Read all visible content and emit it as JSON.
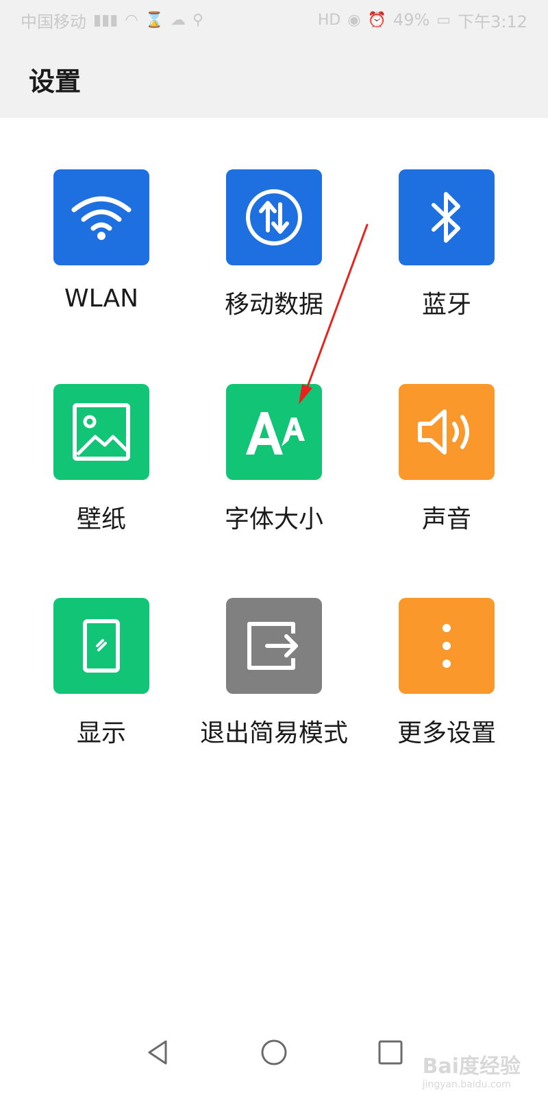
{
  "status_bar": {
    "carrier": "中国移动",
    "battery": "49%",
    "time": "下午3:12"
  },
  "header": {
    "title": "设置"
  },
  "tiles": [
    {
      "label": "WLAN",
      "icon": "wifi-icon",
      "color": "#1e6fe0"
    },
    {
      "label": "移动数据",
      "icon": "mobile-data-icon",
      "color": "#1e6fe0"
    },
    {
      "label": "蓝牙",
      "icon": "bluetooth-icon",
      "color": "#1e6fe0"
    },
    {
      "label": "壁纸",
      "icon": "wallpaper-icon",
      "color": "#12c576"
    },
    {
      "label": "字体大小",
      "icon": "font-size-icon",
      "color": "#12c576"
    },
    {
      "label": "声音",
      "icon": "sound-icon",
      "color": "#fb982c"
    },
    {
      "label": "显示",
      "icon": "display-icon",
      "color": "#12c576"
    },
    {
      "label": "退出简易模式",
      "icon": "exit-icon",
      "color": "#808080"
    },
    {
      "label": "更多设置",
      "icon": "more-icon",
      "color": "#fb982c"
    }
  ],
  "nav_bar": {
    "back": "back-icon",
    "home": "home-icon",
    "recents": "recents-icon"
  },
  "watermark": {
    "text": "Bai度经验",
    "sub": "jingyan.baidu.com"
  },
  "annotation": {
    "color": "#e8231d"
  }
}
